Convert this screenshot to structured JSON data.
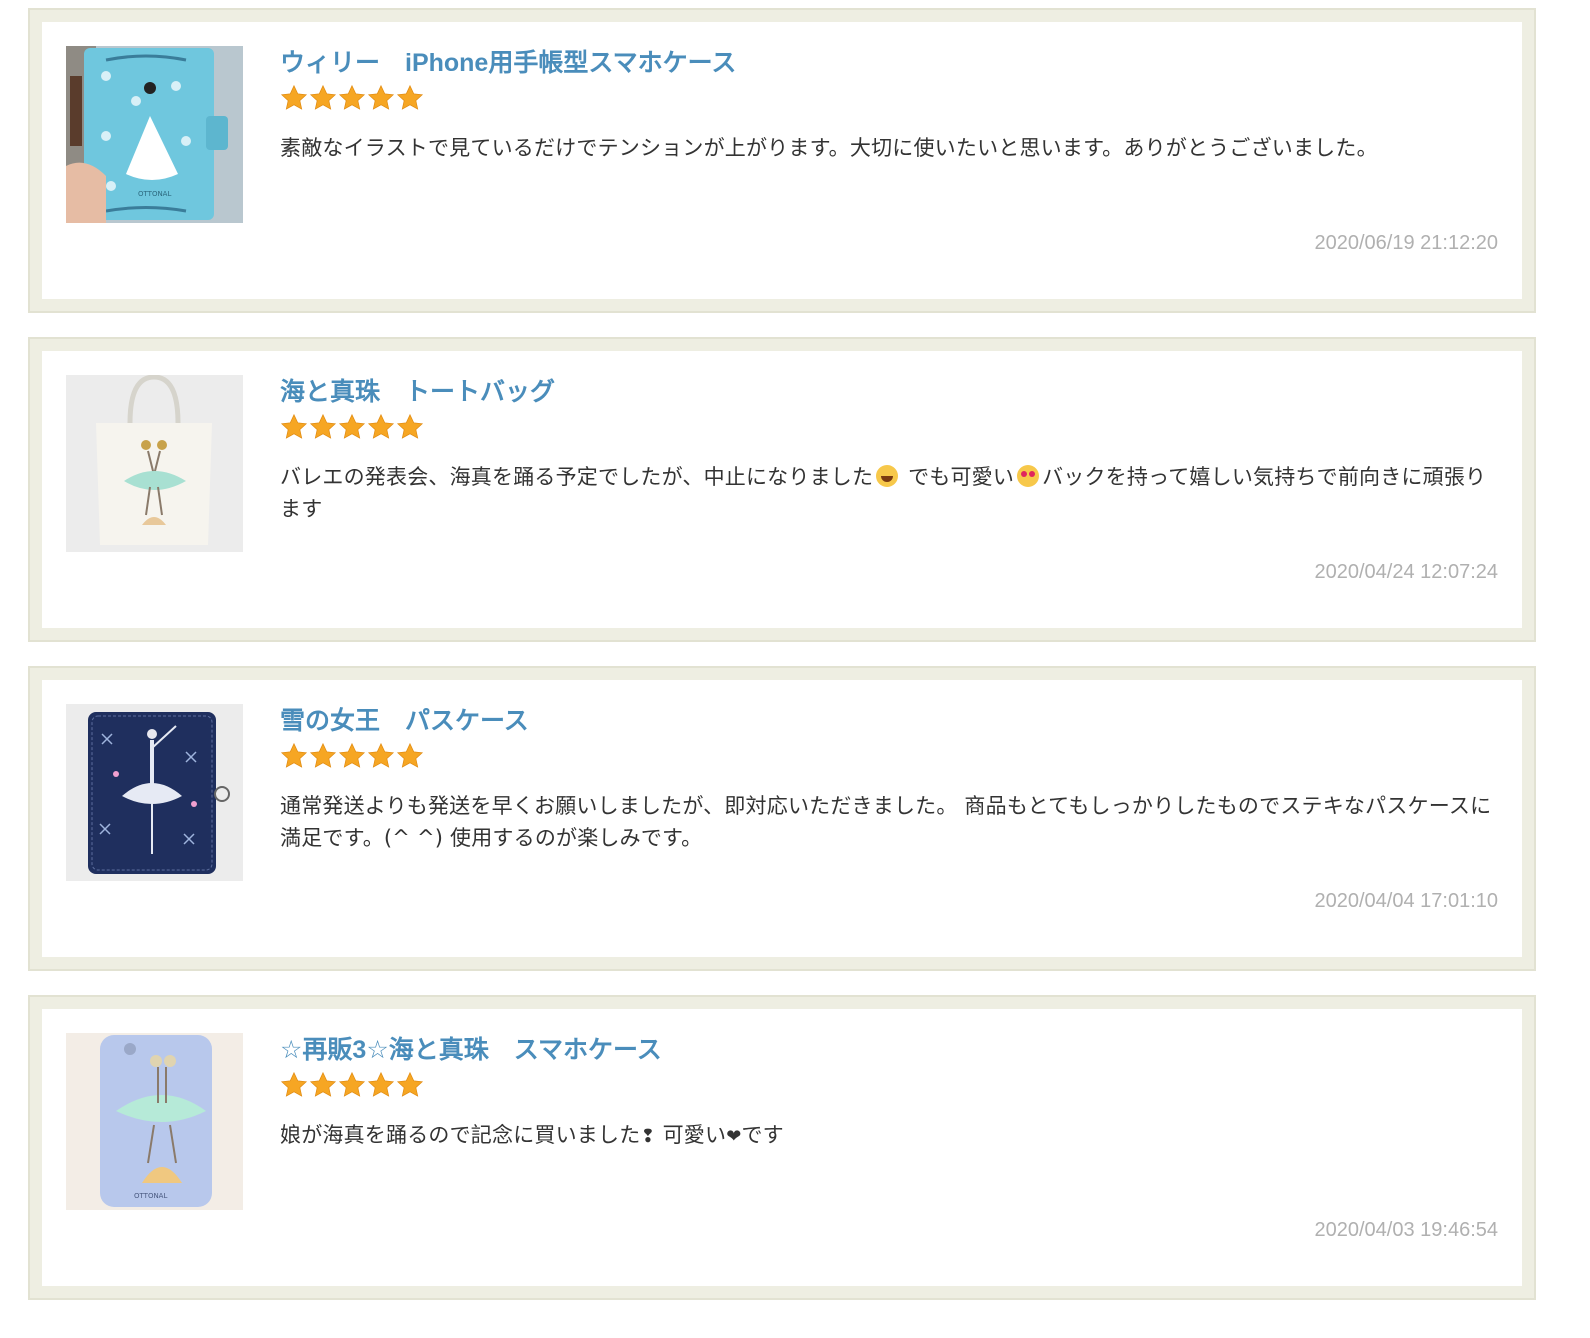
{
  "reviews": [
    {
      "title": "ウィリー　iPhone用手帳型スマホケース",
      "rating": 5,
      "comment": [
        "素敵なイラストで見ているだけでテンションが上がります。大切に使いたいと思います。ありがとうございました。"
      ],
      "date": "2020/06/19 21:12:20",
      "thumbnail_icon": "phone-case-photo"
    },
    {
      "title": "海と真珠　トートバッグ",
      "rating": 5,
      "comment": [
        "バレエの発表会、海真を踊る予定でしたが、中止になりました",
        "でも可愛い",
        "バックを持って嬉しい気持ちで前向きに頑張ります"
      ],
      "date": "2020/04/24 12:07:24",
      "thumbnail_icon": "tote-bag-photo"
    },
    {
      "title": "雪の女王　パスケース",
      "rating": 5,
      "comment": [
        "通常発送よりも発送を早くお願いしましたが、即対応いただきました。 商品もとてもしっかりしたものでステキなパスケースに満足です。(^ ^) 使用するのが楽しみです。"
      ],
      "date": "2020/04/04 17:01:10",
      "thumbnail_icon": "pass-case-photo"
    },
    {
      "title": "☆再販3☆海と真珠　スマホケース",
      "rating": 5,
      "comment": [
        "娘が海真を踊るので記念に買いました",
        "❢",
        " 可愛い",
        "❤",
        "です"
      ],
      "date": "2020/04/03 19:46:54",
      "thumbnail_icon": "smartphone-case-photo"
    }
  ],
  "colors": {
    "title": "#4a8dbb",
    "star": "#f6a623",
    "date": "#b0b0b0",
    "card_frame": "#eeeee2"
  },
  "icons": {
    "star": "star-icon",
    "emoji_1": "laughing-tears-emoji",
    "emoji_2": "heart-eyes-emoji"
  }
}
